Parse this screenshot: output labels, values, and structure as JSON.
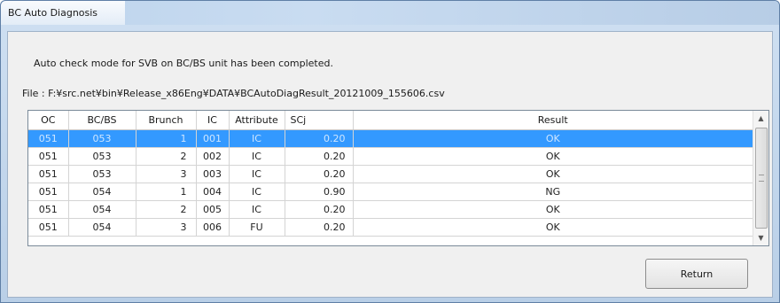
{
  "window": {
    "title": "BC Auto Diagnosis"
  },
  "message": "Auto check mode for SVB on BC/BS unit has been completed.",
  "file": {
    "label": "File : ",
    "path": "F:¥src.net¥bin¥Release_x86Eng¥DATA¥BCAutoDiagResult_20121009_155606.csv"
  },
  "grid": {
    "columns": [
      "OC",
      "BC/BS",
      "Brunch",
      "IC",
      "Attribute",
      "SCj",
      "Result"
    ],
    "rows": [
      {
        "oc": "051",
        "bcbs": "053",
        "brunch": "1",
        "ic": "001",
        "attribute": "IC",
        "scj": "0.20",
        "result": "OK",
        "selected": true
      },
      {
        "oc": "051",
        "bcbs": "053",
        "brunch": "2",
        "ic": "002",
        "attribute": "IC",
        "scj": "0.20",
        "result": "OK",
        "selected": false
      },
      {
        "oc": "051",
        "bcbs": "053",
        "brunch": "3",
        "ic": "003",
        "attribute": "IC",
        "scj": "0.20",
        "result": "OK",
        "selected": false
      },
      {
        "oc": "051",
        "bcbs": "054",
        "brunch": "1",
        "ic": "004",
        "attribute": "IC",
        "scj": "0.90",
        "result": "NG",
        "selected": false
      },
      {
        "oc": "051",
        "bcbs": "054",
        "brunch": "2",
        "ic": "005",
        "attribute": "IC",
        "scj": "0.20",
        "result": "OK",
        "selected": false
      },
      {
        "oc": "051",
        "bcbs": "054",
        "brunch": "3",
        "ic": "006",
        "attribute": "FU",
        "scj": "0.20",
        "result": "OK",
        "selected": false
      }
    ]
  },
  "buttons": {
    "return_label": "Return"
  },
  "colors": {
    "selection": "#3399ff",
    "titlebar": "#c9dcf1"
  },
  "icons": {
    "scroll_up": "scroll-up-arrow-icon",
    "scroll_down": "scroll-down-arrow-icon"
  }
}
